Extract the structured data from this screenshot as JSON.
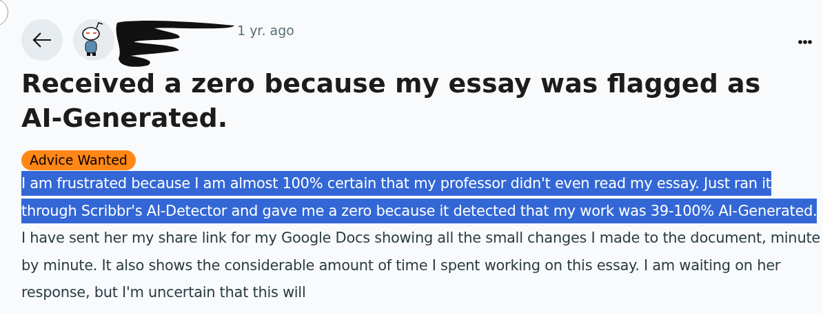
{
  "post": {
    "time": "1 yr. ago",
    "title": "Received a zero because my essay was flagged as AI-Generated.",
    "flair": {
      "label": "Advice Wanted",
      "color": "#ff8717"
    },
    "body": [
      {
        "text": "I am frustrated because I am almost 100% certain that my professor didn't even read my essay. Just ran it through Scribbr's AI-Detector and gave me a zero because it detected that my work was 39-100% AI-Generated.",
        "selected": true
      },
      {
        "text": " I have sent her my share link for my Google Docs showing all the small changes I made to the document, minute by minute. It also shows the considerable amount of time I spent working on this essay. I am waiting on her response, but I'm uncertain that this will",
        "selected": false
      }
    ]
  }
}
